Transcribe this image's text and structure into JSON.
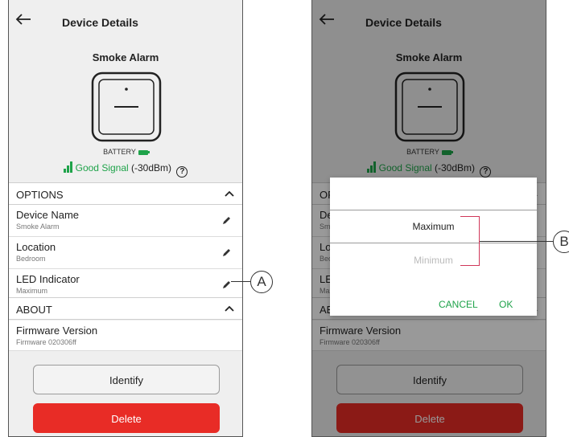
{
  "header": {
    "title": "Device Details"
  },
  "device": {
    "name": "Smoke Alarm",
    "battery_label": "BATTERY",
    "signal_status": "Good Signal",
    "signal_value": "(-30dBm)",
    "help_glyph": "?"
  },
  "options_section": {
    "label": "OPTIONS"
  },
  "rows": {
    "device_name": {
      "title": "Device Name",
      "value": "Smoke Alarm"
    },
    "location": {
      "title": "Location",
      "value": "Bedroom"
    },
    "led_indicator": {
      "title": "LED Indicator",
      "value": "Maximum"
    }
  },
  "about_section": {
    "label": "ABOUT"
  },
  "firmware": {
    "title": "Firmware Version",
    "value": "Firmware 020306ff"
  },
  "buttons": {
    "identify": "Identify",
    "delete": "Delete"
  },
  "modal": {
    "option_max": "Maximum",
    "option_min": "Minimum",
    "cancel": "CANCEL",
    "ok": "OK"
  },
  "callouts": {
    "a": "A",
    "b": "B"
  },
  "colors": {
    "accent_green": "#1fa34a",
    "delete_red": "#e82c26",
    "bracket_pink": "#d0375a",
    "background": "#efefef"
  },
  "icons": {
    "back": "arrow-left-icon",
    "edit": "pencil-icon",
    "collapse": "chevron-up-icon",
    "help": "question-circle-icon",
    "signal": "signal-bars-icon",
    "battery": "battery-icon"
  }
}
